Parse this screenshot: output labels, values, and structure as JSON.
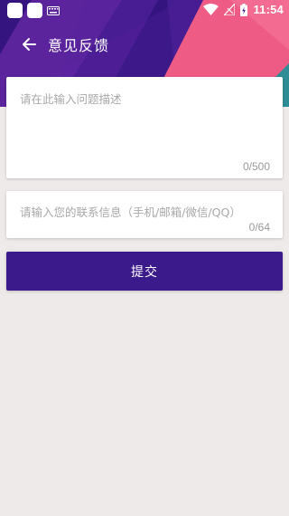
{
  "status_bar": {
    "time": "11:54",
    "icons": [
      "notification-square-icon",
      "notification-square-icon",
      "keyboard-icon",
      "wifi-icon",
      "no-signal-icon",
      "battery-charging-icon"
    ]
  },
  "toolbar": {
    "back_icon": "arrow-left-icon",
    "title": "意见反馈"
  },
  "description": {
    "placeholder": "请在此输入问题描述",
    "value": "",
    "counter": "0/500"
  },
  "contact": {
    "placeholder": "请输入您的联系信息（手机/邮箱/微信/QQ）",
    "value": "",
    "counter": "0/64"
  },
  "submit": {
    "label": "提交"
  },
  "colors": {
    "header_purple": "#3f1b8c",
    "header_pink": "#ef5d87",
    "header_teal": "#2f8e95",
    "button": "#3b1a8c",
    "background": "#efeaea"
  }
}
